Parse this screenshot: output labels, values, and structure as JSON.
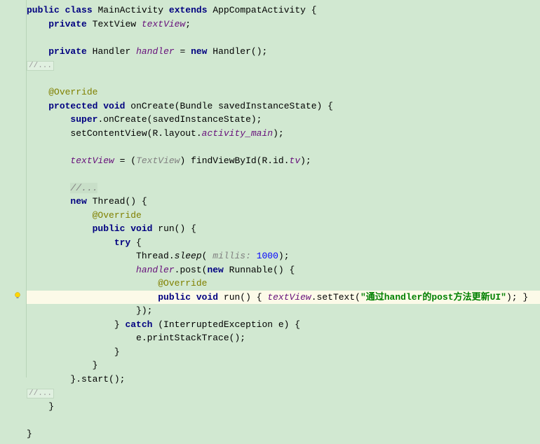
{
  "code": {
    "l1_public": "public",
    "l1_class": "class",
    "l1_MainActivity": "MainActivity",
    "l1_extends": "extends",
    "l1_AppCompatActivity": "AppCompatActivity",
    "l1_brace": " {",
    "l2_private": "private",
    "l2_TextView": "TextView",
    "l2_field": "textView",
    "l2_semi": ";",
    "l4_private": "private",
    "l4_Handler1": "Handler",
    "l4_field": "handler",
    "l4_eq": " = ",
    "l4_new": "new",
    "l4_Handler2": "Handler();",
    "l5_collapse": "//...",
    "l7_annotation": "@Override",
    "l8_protected": "protected",
    "l8_void": "void",
    "l8_onCreate": "onCreate(Bundle savedInstanceState) {",
    "l9_super": "super",
    "l9_rest": ".onCreate(savedInstanceState);",
    "l10_setContentView": "setContentView(R.layout.",
    "l10_activity_main": "activity_main",
    "l10_end": ");",
    "l12_field": "textView",
    "l12_eq": " = (",
    "l12_cast": "TextView",
    "l12_findViewById": ") findViewById(R.id.",
    "l12_tv": "tv",
    "l12_end": ");",
    "l14_comment": "//...",
    "l15_new": "new",
    "l15_Thread": "Thread() {",
    "l16_annotation": "@Override",
    "l17_public": "public",
    "l17_void": "void",
    "l17_run": "run() {",
    "l18_try": "try",
    "l18_brace": " {",
    "l19_Thread": "Thread.",
    "l19_sleep": "sleep",
    "l19_paren": "( ",
    "l19_param": "millis:",
    "l19_num": "1000",
    "l19_end": ");",
    "l20_field": "handler",
    "l20_post": ".post(",
    "l20_new": "new",
    "l20_Runnable": "Runnable() {",
    "l21_annotation": "@Override",
    "l22_public": "public",
    "l22_void": "void",
    "l22_run": "run() { ",
    "l22_field": "textView",
    "l22_setText": ".setText(",
    "l22_str": "\"通过handler的post方法更新UI\"",
    "l22_end": "); }",
    "l23_close": "});",
    "l24_brace": "} ",
    "l24_catch": "catch",
    "l24_exc": " (InterruptedException e) {",
    "l25_print": "e.printStackTrace();",
    "l26_brace": "}",
    "l27_brace": "}",
    "l28_start": "}.start();",
    "l29_collapse": "//...",
    "l30_brace": "}",
    "l32_brace": "}"
  }
}
